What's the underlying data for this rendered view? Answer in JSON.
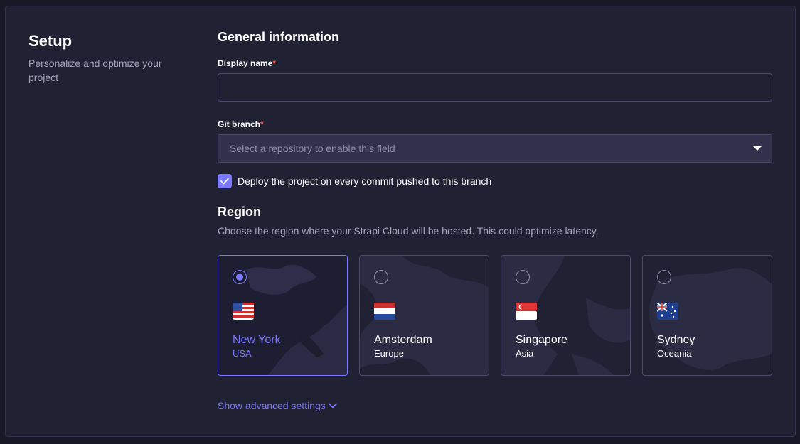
{
  "colors": {
    "background": "#181826",
    "panel": "#212134",
    "accent": "#7b79ff",
    "required": "#ee5e52",
    "muted_text": "#a5a5ba"
  },
  "sidebar": {
    "title": "Setup",
    "description": "Personalize and optimize your project"
  },
  "general": {
    "title": "General information",
    "display_name": {
      "label": "Display name",
      "required_mark": "*",
      "value": "",
      "placeholder": ""
    },
    "git_branch": {
      "label": "Git branch",
      "required_mark": "*",
      "placeholder": "Select a repository to enable this field",
      "icon": "caret-down-icon"
    },
    "deploy_checkbox": {
      "checked": true,
      "label": "Deploy the project on every commit pushed to this branch",
      "icon": "check-icon"
    }
  },
  "region": {
    "title": "Region",
    "description": "Choose the region where your Strapi Cloud will be hosted. This could optimize latency.",
    "options": [
      {
        "name": "New York",
        "sub": "USA",
        "selected": true,
        "flag_icon": "us-flag-icon"
      },
      {
        "name": "Amsterdam",
        "sub": "Europe",
        "selected": false,
        "flag_icon": "nl-flag-icon"
      },
      {
        "name": "Singapore",
        "sub": "Asia",
        "selected": false,
        "flag_icon": "sg-flag-icon"
      },
      {
        "name": "Sydney",
        "sub": "Oceania",
        "selected": false,
        "flag_icon": "au-flag-icon"
      }
    ]
  },
  "advanced": {
    "label": "Show advanced settings",
    "icon": "chevron-down-icon"
  }
}
